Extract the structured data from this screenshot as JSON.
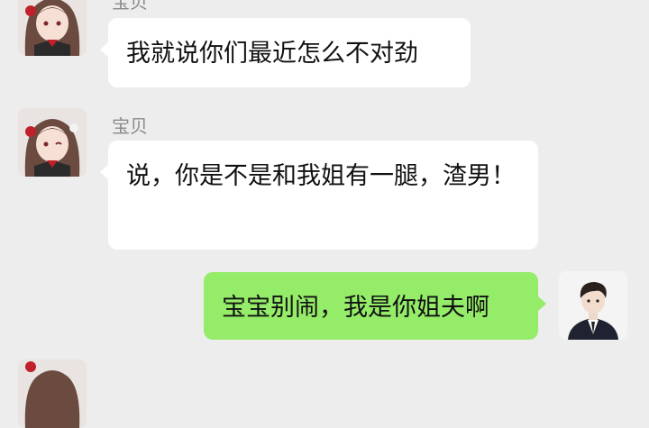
{
  "messages": [
    {
      "sender": "宝贝",
      "text": "我就说你们最近怎么不对劲"
    },
    {
      "sender": "宝贝",
      "text": "说，你是不是和我姐有一腿，渣男！"
    },
    {
      "sender": "",
      "text": "宝宝别闹，我是你姐夫啊"
    }
  ],
  "colors": {
    "background": "#ededed",
    "incoming_bubble": "#ffffff",
    "outgoing_bubble": "#95ec69",
    "sender_name": "#8a8a8a"
  },
  "icons": {
    "incoming_avatar": "anime-girl-avatar",
    "outgoing_avatar": "man-in-suit-avatar"
  }
}
